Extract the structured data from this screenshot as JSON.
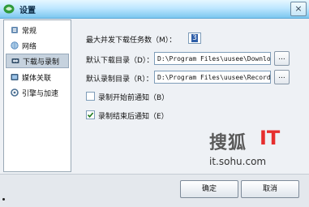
{
  "window": {
    "title": "设置",
    "close_label": "×"
  },
  "sidebar": {
    "items": [
      {
        "label": "常规",
        "icon": "general-icon"
      },
      {
        "label": "网络",
        "icon": "network-globe-icon"
      },
      {
        "label": "下载与录制",
        "icon": "download-record-icon",
        "active": true
      },
      {
        "label": "媒体关联",
        "icon": "media-association-icon"
      },
      {
        "label": "引擎与加速",
        "icon": "engine-acceleration-icon"
      }
    ]
  },
  "download": {
    "max_tasks_label": "最大并发下载任务数（M）：",
    "max_tasks_value": "3",
    "download_dir_label": "默认下载目录（D）：",
    "download_dir_value": "D:\\Program Files\\uusee\\Download",
    "record_dir_label": "默认录制目录（R）：",
    "record_dir_value": "D:\\Program Files\\uusee\\Record",
    "browse_label": "...",
    "notify_before_label": "录制开始前通知（B）",
    "notify_before_checked": false,
    "notify_after_label": "录制结束后通知（E）",
    "notify_after_checked": true
  },
  "watermark": {
    "brand_cn": "搜狐",
    "brand_it": "IT",
    "url": "it.sohu.com"
  },
  "footer": {
    "ok_label": "确定",
    "cancel_label": "取消"
  },
  "colors": {
    "accent": "#7cc7ef",
    "watermark_red": "#e62e2e"
  }
}
